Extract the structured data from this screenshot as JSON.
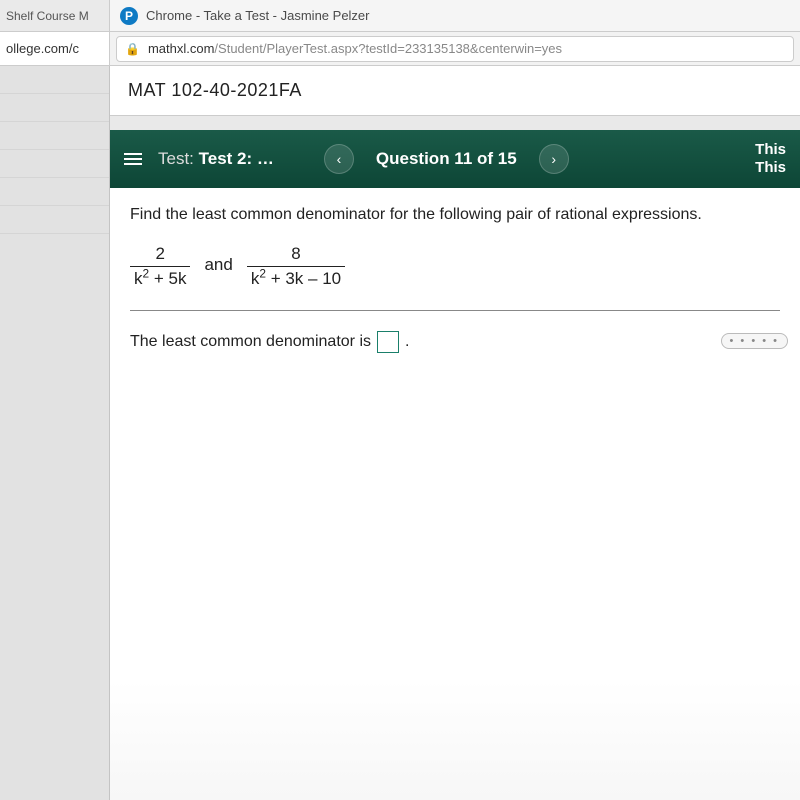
{
  "os": {
    "bg_tab": "Shelf Course M",
    "pearson_glyph": "P",
    "window_title": "Chrome - Take a Test - Jasmine Pelzer"
  },
  "addr": {
    "bg_tab2": "ollege.com/c",
    "lock_glyph": "🔒",
    "url_host": "mathxl.com",
    "url_path": "/Student/PlayerTest.aspx?testId=233135138&centerwin=yes"
  },
  "course": {
    "title": "MAT 102-40-2021FA"
  },
  "test_header": {
    "label": "Test:",
    "name": "Test 2: …",
    "prev_glyph": "‹",
    "question_counter": "Question 11 of 15",
    "next_glyph": "›",
    "this1": "This",
    "this2": "This"
  },
  "question": {
    "prompt": "Find the least common denominator for the following pair of rational expressions.",
    "frac1_num": "2",
    "frac1_den_a": "k",
    "frac1_den_b": " + 5k",
    "and": "and",
    "frac2_num": "8",
    "frac2_den_a": "k",
    "frac2_den_b": " + 3k – 10",
    "answer_label": "The least common denominator is ",
    "period": "."
  },
  "handle_dots": "• • • • •"
}
